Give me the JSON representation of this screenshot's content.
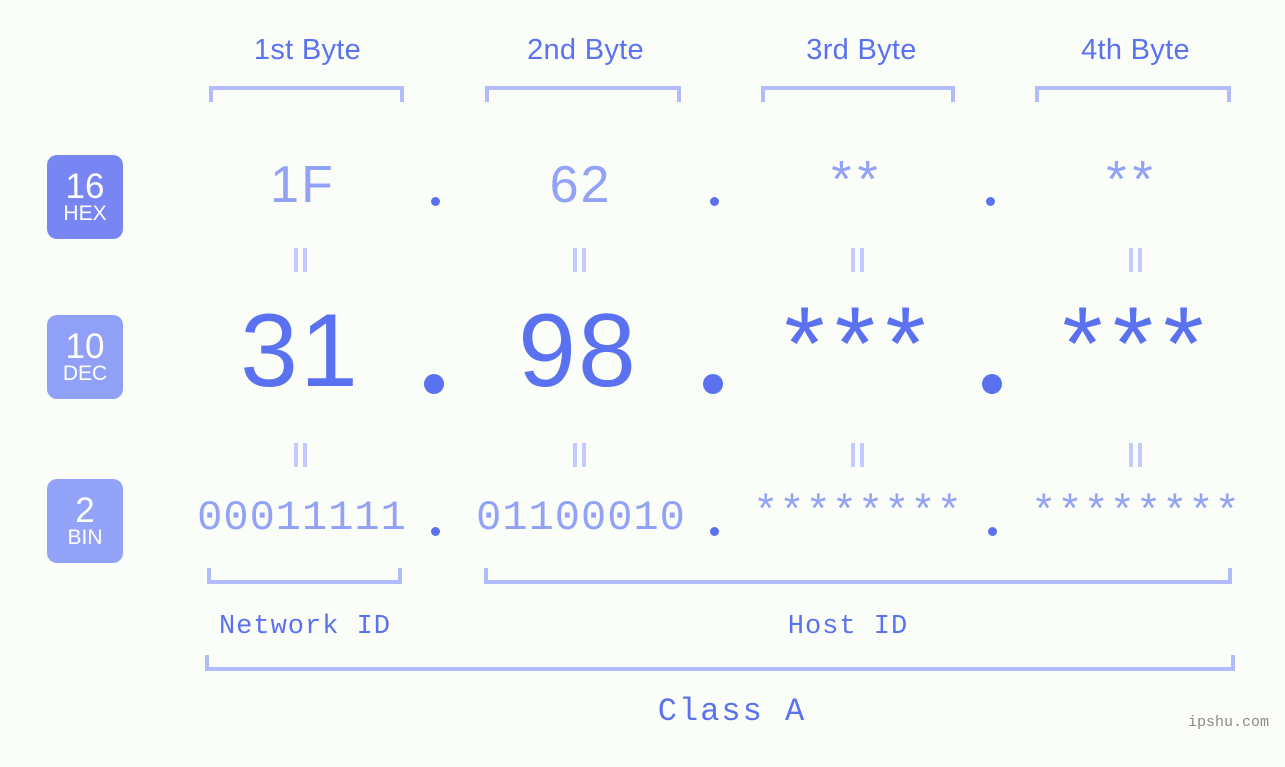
{
  "meta": {
    "background": "#fbfdf8",
    "accent": "#5b72f0",
    "accent_light": "#92a2f7",
    "bracket": "#b3bcfb",
    "watermark": "ipshu.com"
  },
  "byte_headers": [
    {
      "label": "1st Byte"
    },
    {
      "label": "2nd Byte"
    },
    {
      "label": "3rd Byte"
    },
    {
      "label": "4th Byte"
    }
  ],
  "rows": [
    {
      "badge_num": "16",
      "badge_label": "HEX",
      "badge_color": "#7886f3",
      "values": [
        "1F",
        "62",
        "**",
        "**"
      ]
    },
    {
      "badge_num": "10",
      "badge_label": "DEC",
      "badge_color": "#91a0f7",
      "values": [
        "31",
        "98",
        "***",
        "***"
      ]
    },
    {
      "badge_num": "2",
      "badge_label": "BIN",
      "badge_color": "#93a3f8",
      "values": [
        "00011111",
        "01100010",
        "********",
        "********"
      ]
    }
  ],
  "separators": {
    "dot": ".",
    "equals": "="
  },
  "footer": {
    "network_id": "Network ID",
    "host_id": "Host ID",
    "class_label": "Class A"
  }
}
